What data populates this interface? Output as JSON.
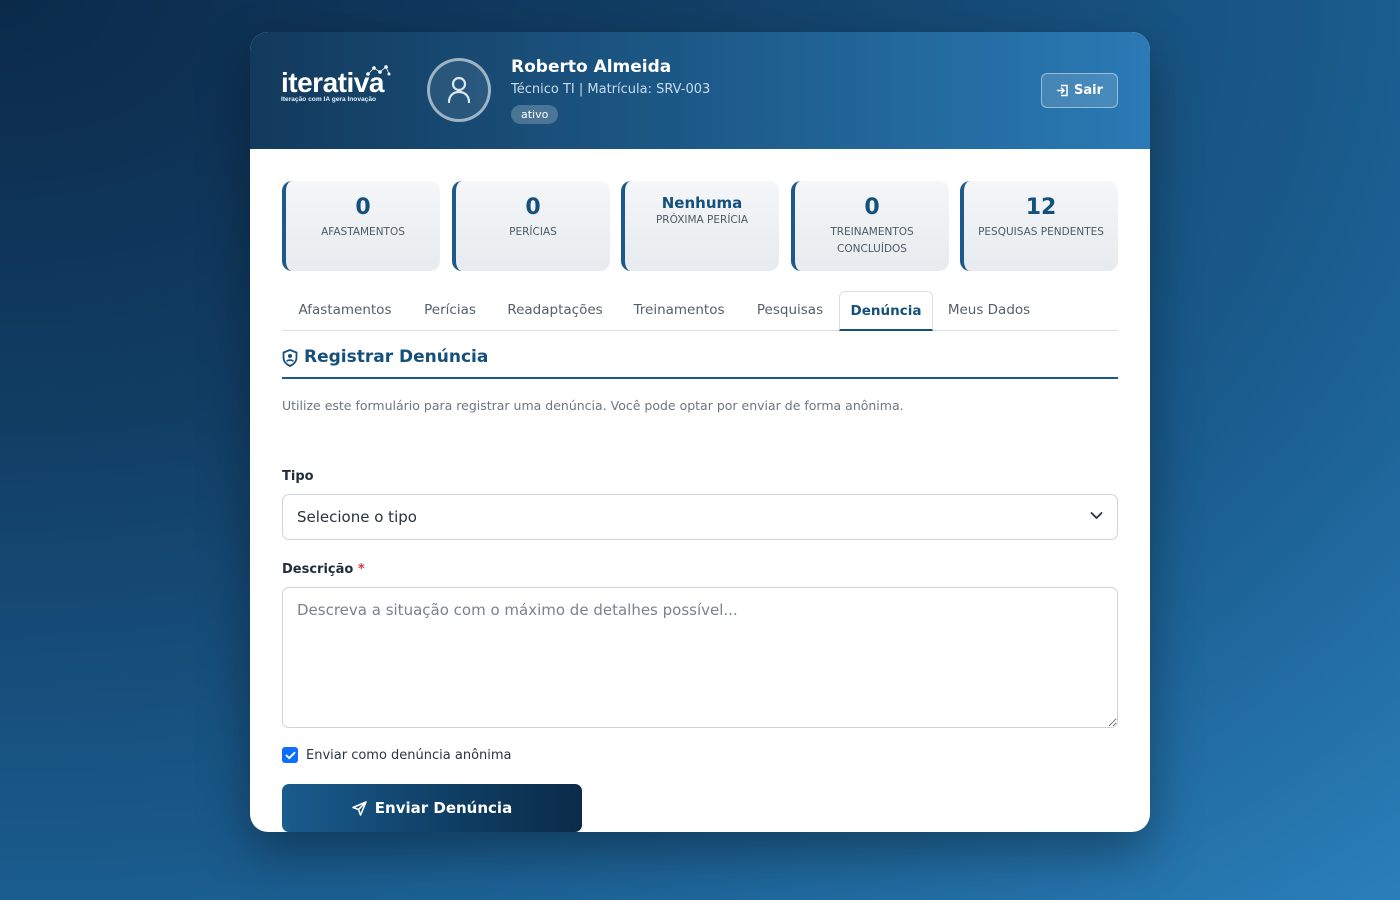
{
  "brand": {
    "name": "iterativa",
    "tagline": "Iteração com IA gera Inovação"
  },
  "user": {
    "name": "Roberto Almeida",
    "role": "Técnico TI | Matrícula: SRV-003",
    "status": "ativo",
    "logout_label": "Sair"
  },
  "stats": [
    {
      "value": "0",
      "label": "AFASTAMENTOS"
    },
    {
      "value": "0",
      "label": "PERÍCIAS"
    },
    {
      "value": "Nenhuma",
      "label": "PRÓXIMA PERÍCIA"
    },
    {
      "value": "0",
      "label": "TREINAMENTOS CONCLUÍDOS"
    },
    {
      "value": "12",
      "label": "PESQUISAS PENDENTES"
    }
  ],
  "tabs": [
    {
      "label": "Afastamentos"
    },
    {
      "label": "Perícias"
    },
    {
      "label": "Readaptações"
    },
    {
      "label": "Treinamentos"
    },
    {
      "label": "Pesquisas"
    },
    {
      "label": "Denúncia"
    },
    {
      "label": "Meus Dados"
    }
  ],
  "active_tab": "Denúncia",
  "form": {
    "title": "Registrar Denúncia",
    "intro": "Utilize este formulário para registrar uma denúncia. Você pode optar por enviar de forma anônima.",
    "tipo_label": "Tipo",
    "tipo_value": "Selecione o tipo",
    "descricao_label": "Descrição",
    "required_mark": "*",
    "descricao_placeholder": "Descreva a situação com o máximo de detalhes possível...",
    "anon_label": "Enviar como denúncia anônima",
    "anon_checked": true,
    "submit_label": "Enviar Denúncia"
  },
  "colors": {
    "primary": "#15507d",
    "checkbox": "#0d6efd",
    "required": "#d43a3a"
  }
}
